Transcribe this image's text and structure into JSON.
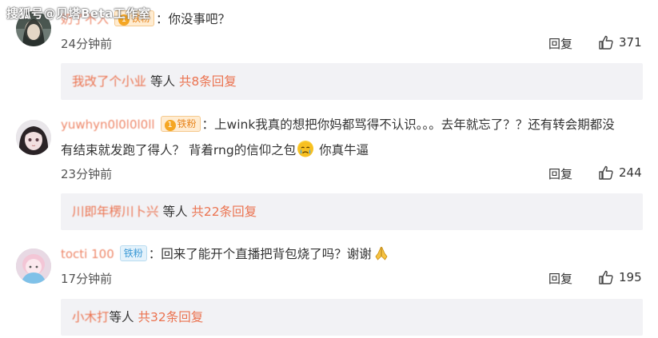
{
  "watermark": "搜狐号@贝塔Beta工作室",
  "comments": [
    {
      "username": "奶了不入",
      "badge": "铁粉",
      "badge_level": "1",
      "text": "：你没事吧？",
      "time": "24分钟前",
      "reply_label": "回复",
      "like_count": "371",
      "replies": {
        "names": "我改了个小业",
        "others": "等人",
        "count_link": "共8条回复"
      }
    },
    {
      "username": "yuwhyn0l0l0l0ll",
      "badge": "铁粉",
      "badge_level": "1",
      "text_line1": "：上wink我真的想把你妈都骂得不认识。。。去年就忘了？？还有转会期都没",
      "text_line2_a": "有结束就发跑了得人？ 背着rng的信仰之包",
      "text_line2_b": " 你真牛逼",
      "time": "23分钟前",
      "reply_label": "回复",
      "like_count": "244",
      "replies": {
        "names": "川即年楞川卜兴",
        "others": "等人",
        "count_link": "共22条回复"
      }
    },
    {
      "username": "tocti 100",
      "badge": "铁粉",
      "text": "：回来了能开个直播把背包烧了吗？谢谢",
      "time": "17分钟前",
      "reply_label": "回复",
      "like_count": "195",
      "replies": {
        "names": "小木打",
        "others": "等人",
        "count_link": "共32条回复"
      }
    }
  ],
  "colors": {
    "username": "#eb7350",
    "reply_bg": "#f2f2f5",
    "iron_badge_blue": "#3d9ad6"
  },
  "icons": [
    "like-icon",
    "level-badge-icon",
    "crying-face-emoji",
    "praying-hands-emoji"
  ]
}
